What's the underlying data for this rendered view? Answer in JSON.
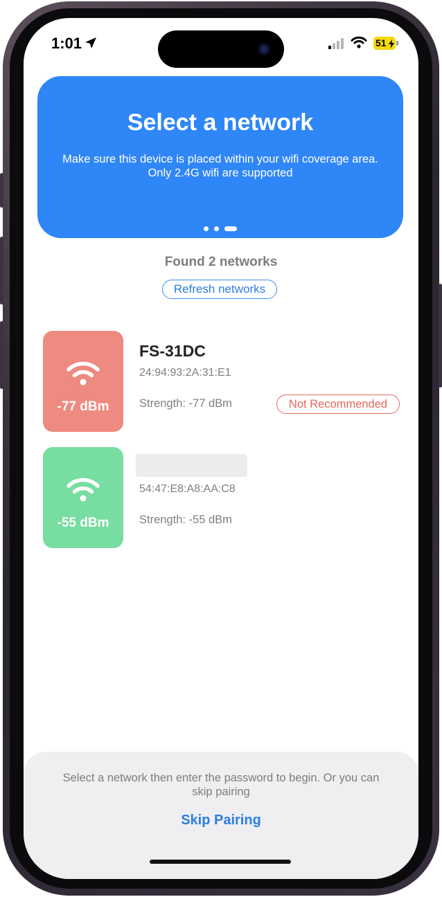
{
  "status_bar": {
    "time": "1:01",
    "battery_level": "51",
    "icons": [
      "location-arrow-icon",
      "cellular-signal-icon",
      "wifi-icon",
      "battery-charging-icon"
    ]
  },
  "header": {
    "title": "Select a network",
    "subtitle": "Make sure this device is placed within your wifi coverage area. Only 2.4G wifi are supported",
    "page_indicator": {
      "count": 3,
      "active_index": 2
    },
    "background_color": "#2f86f6"
  },
  "found_label": "Found 2 networks",
  "refresh_label": "Refresh networks",
  "networks": [
    {
      "name": "FS-31DC",
      "mac": "24:94:93:2A:31:E1",
      "tile_signal": "-77 dBm",
      "strength": "Strength: -77 dBm",
      "badge": "Not Recommended",
      "tile_color": "#ee8a80",
      "icon": "wifi-icon"
    },
    {
      "name": "",
      "name_redacted": true,
      "mac": "54:47:E8:A8:AA:C8",
      "tile_signal": "-55 dBm",
      "strength": "Strength: -55 dBm",
      "tile_color": "#77dda0",
      "icon": "wifi-icon"
    }
  ],
  "bottom": {
    "text": "Select a network then enter the password to begin. Or you can skip pairing",
    "skip_label": "Skip Pairing"
  },
  "colors": {
    "accent": "#2a7de4",
    "warning": "#e0685e"
  }
}
